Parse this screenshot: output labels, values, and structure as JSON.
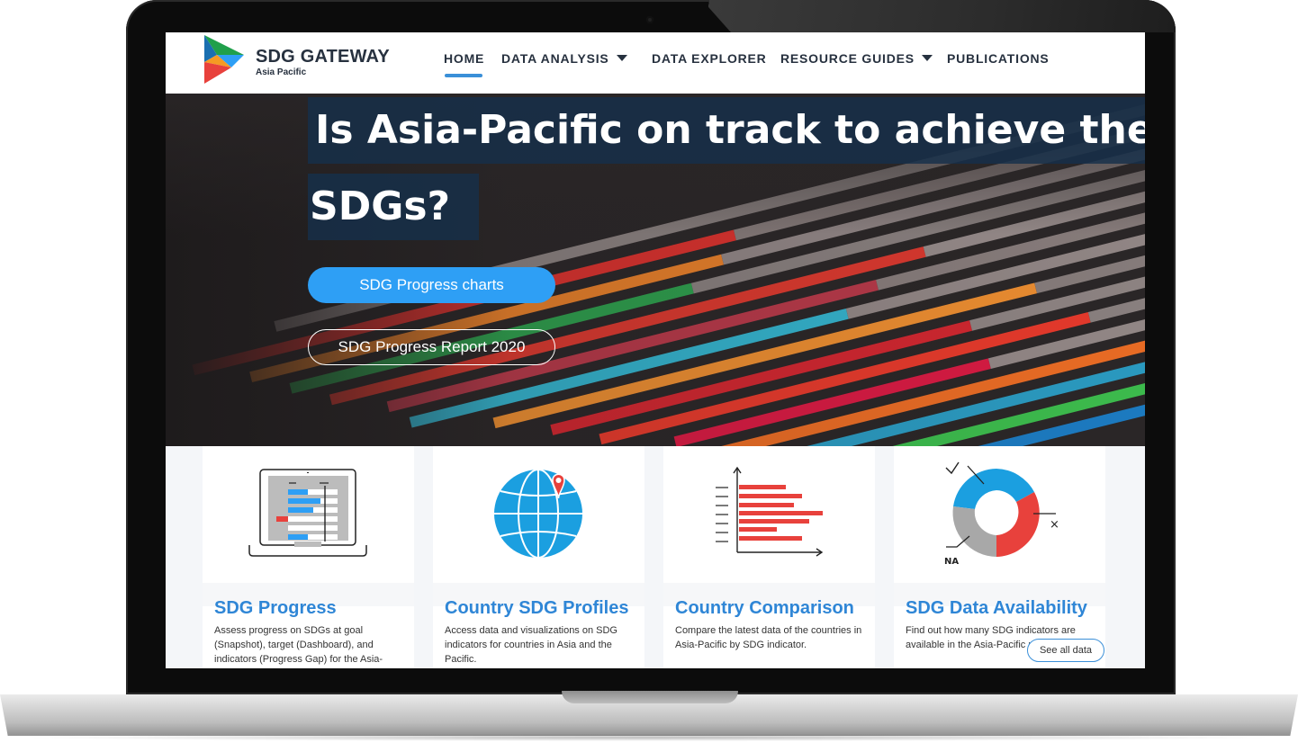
{
  "brand": {
    "title": "SDG GATEWAY",
    "subtitle": "Asia Pacific",
    "colors": [
      "#e8413c",
      "#f59a23",
      "#20a04b",
      "#2e9ff5"
    ]
  },
  "nav": {
    "items": [
      {
        "label": "HOME",
        "active": true,
        "dropdown": false
      },
      {
        "label": "DATA ANALYSIS",
        "active": false,
        "dropdown": true
      },
      {
        "label": "DATA EXPLORER",
        "active": false,
        "dropdown": false
      },
      {
        "label": "RESOURCE GUIDES",
        "active": false,
        "dropdown": true
      },
      {
        "label": "PUBLICATIONS",
        "active": false,
        "dropdown": false
      }
    ],
    "active_color": "#3a8fd8"
  },
  "hero": {
    "title_line1": "Is Asia-Pacific on track to achieve the",
    "title_line2": "SDGs?",
    "primary_button": "SDG Progress charts",
    "secondary_button": "SDG Progress Report 2020",
    "primary_color": "#2e9ff5"
  },
  "cards": [
    {
      "title": "SDG Progress",
      "description": "Assess progress on SDGs at goal (Snapshot), target (Dashboard), and indicators (Progress Gap) for the Asia-",
      "icon": "laptop-dashboard-icon"
    },
    {
      "title": "Country SDG Profiles",
      "description": "Access data and visualizations on SDG indicators for countries in Asia and the Pacific.",
      "icon": "globe-pin-icon"
    },
    {
      "title": "Country Comparison",
      "description": "Compare the latest data of the countries in Asia-Pacific by SDG indicator.",
      "icon": "bar-chart-icon"
    },
    {
      "title": "SDG Data Availability",
      "description": "Find out how many SDG indicators are available in the Asia-Pacific region.",
      "icon": "donut-chart-icon",
      "donut_labels": [
        "✓",
        "×",
        "NA"
      ]
    }
  ],
  "see_all": "See all data",
  "title_color": "#2f86d6"
}
